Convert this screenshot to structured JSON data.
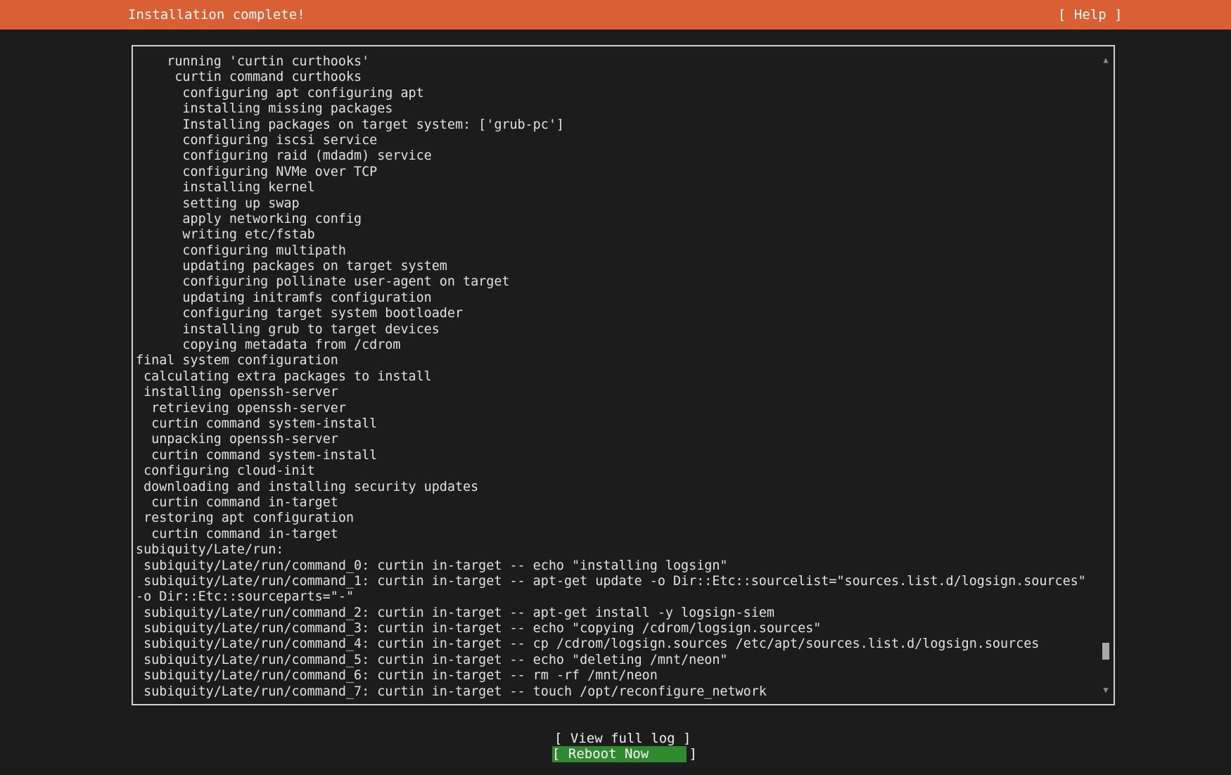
{
  "header": {
    "title": "Installation complete!",
    "help_label": "[ Help ]"
  },
  "log": {
    "lines": [
      "    running 'curtin curthooks'",
      "     curtin command curthooks",
      "      configuring apt configuring apt",
      "      installing missing packages",
      "      Installing packages on target system: ['grub-pc']",
      "      configuring iscsi service",
      "      configuring raid (mdadm) service",
      "      configuring NVMe over TCP",
      "      installing kernel",
      "      setting up swap",
      "      apply networking config",
      "      writing etc/fstab",
      "      configuring multipath",
      "      updating packages on target system",
      "      configuring pollinate user-agent on target",
      "      updating initramfs configuration",
      "      configuring target system bootloader",
      "      installing grub to target devices",
      "      copying metadata from /cdrom",
      "final system configuration",
      " calculating extra packages to install",
      " installing openssh-server",
      "  retrieving openssh-server",
      "  curtin command system-install",
      "  unpacking openssh-server",
      "  curtin command system-install",
      " configuring cloud-init",
      " downloading and installing security updates",
      "  curtin command in-target",
      " restoring apt configuration",
      "  curtin command in-target",
      "subiquity/Late/run:",
      " subiquity/Late/run/command_0: curtin in-target -- echo \"installing logsign\"",
      " subiquity/Late/run/command_1: curtin in-target -- apt-get update -o Dir::Etc::sourcelist=\"sources.list.d/logsign.sources\"",
      "-o Dir::Etc::sourceparts=\"-\"",
      " subiquity/Late/run/command_2: curtin in-target -- apt-get install -y logsign-siem",
      " subiquity/Late/run/command_3: curtin in-target -- echo \"copying /cdrom/logsign.sources\"",
      " subiquity/Late/run/command_4: curtin in-target -- cp /cdrom/logsign.sources /etc/apt/sources.list.d/logsign.sources",
      " subiquity/Late/run/command_5: curtin in-target -- echo \"deleting /mnt/neon\"",
      " subiquity/Late/run/command_6: curtin in-target -- rm -rf /mnt/neon",
      " subiquity/Late/run/command_7: curtin in-target -- touch /opt/reconfigure_network"
    ],
    "scroll_up_arrow": "▲",
    "scroll_down_arrow": "▼",
    "scroll_position": 0.96
  },
  "actions": {
    "view_log_label": "[ View full log ]",
    "reboot_label": "[ Reboot Now     ]"
  },
  "colors": {
    "header_bg": "#d95f35",
    "page_bg": "#1c1c1c",
    "selected_button_bg": "#2f8a2f"
  }
}
